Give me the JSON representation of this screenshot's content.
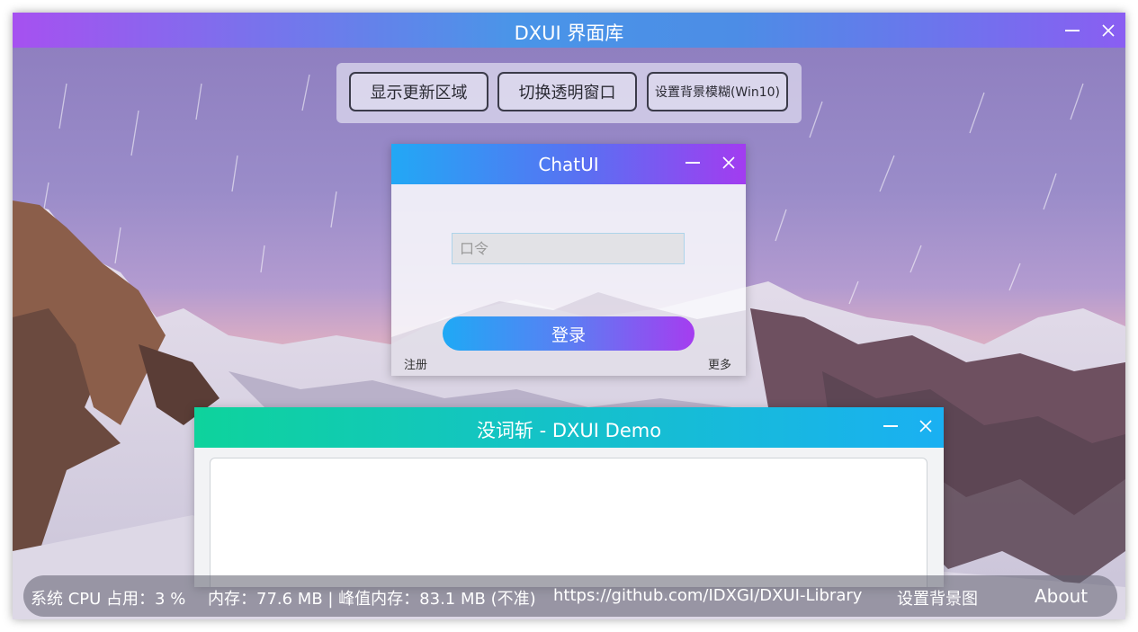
{
  "main_window": {
    "title": "DXUI 界面库"
  },
  "toolbar": {
    "buttons": [
      {
        "label": "显示更新区域"
      },
      {
        "label": "切换透明窗口"
      },
      {
        "label": "设置背景模糊(Win10)"
      }
    ]
  },
  "chat_window": {
    "title": "ChatUI",
    "password_placeholder": "口令",
    "login_label": "登录",
    "register_label": "注册",
    "more_label": "更多"
  },
  "demo_window": {
    "title": "没词斩 - DXUI Demo"
  },
  "status_bar": {
    "cpu": "系统 CPU 占用：3 %",
    "memory": "内存：77.6 MB | 峰值内存：83.1 MB (不准)",
    "repo_link": "https://github.com/IDXGI/DXUI-Library",
    "set_background": "设置背景图",
    "about": "About"
  },
  "icons": {
    "minimize": "minimize-icon",
    "close": "close-icon"
  },
  "colors": {
    "title_gradient_start": "#a651f0",
    "title_gradient_mid": "#4a95e8",
    "title_gradient_end": "#8a5ef2",
    "chat_gradient_start": "#22a8f5",
    "chat_gradient_end": "#a23cf0",
    "demo_gradient_start": "#0ed39c",
    "demo_gradient_end": "#1ab0f2"
  }
}
